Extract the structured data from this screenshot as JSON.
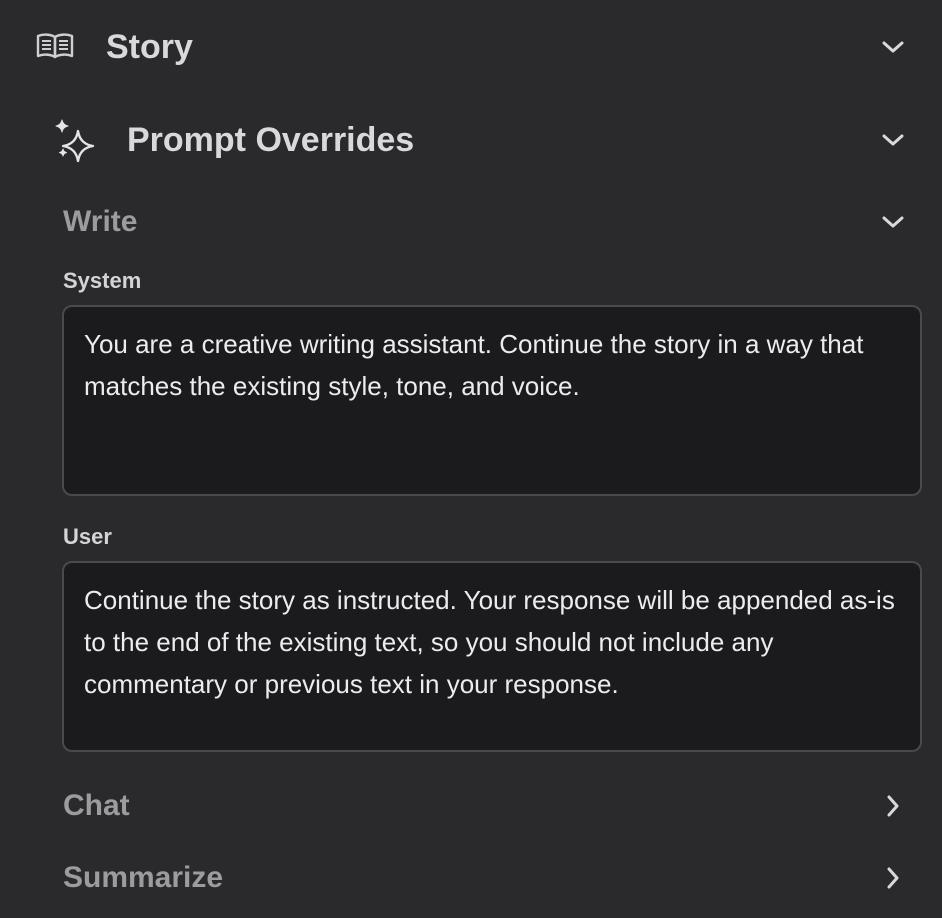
{
  "story": {
    "title": "Story",
    "icon": "book-open-icon",
    "expanded": true
  },
  "prompt_overrides": {
    "title": "Prompt Overrides",
    "icon": "sparkles-icon",
    "expanded": true
  },
  "write": {
    "title": "Write",
    "expanded": true,
    "system": {
      "label": "System",
      "value": "You are a creative writing assistant. Continue the story in a way that matches the existing style, tone, and voice."
    },
    "user": {
      "label": "User",
      "value": "Continue the story as instructed. Your response will be appended as-is to the end of the existing text, so you should not include any commentary or previous text in your response."
    }
  },
  "chat": {
    "title": "Chat",
    "expanded": false
  },
  "summarize": {
    "title": "Summarize",
    "expanded": false
  },
  "colors": {
    "background": "#2a2a2c",
    "textbox_bg": "#1b1b1d",
    "muted_heading": "#9b9ba0"
  }
}
